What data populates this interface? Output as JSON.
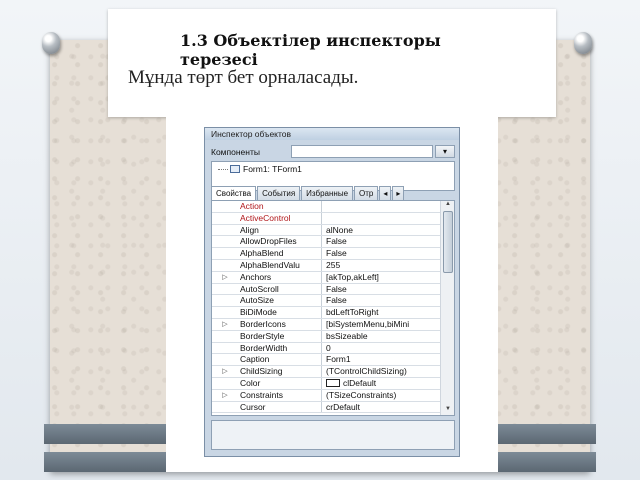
{
  "slide": {
    "title": "1.3 Объектілер инспекторы терезесі",
    "subtitle": "Мұнда төрт бет орналасады."
  },
  "inspector": {
    "window_title": "Инспектор объектов",
    "components_label": "Компоненты",
    "combo_button_icon": "dropdown-icon",
    "tree_item": "Form1: TForm1",
    "tabs": [
      {
        "label": "Свойства",
        "active": true
      },
      {
        "label": "События",
        "active": false
      },
      {
        "label": "Избранные",
        "active": false
      },
      {
        "label": "Отр",
        "active": false
      }
    ],
    "tab_nav": [
      "◂",
      "▸"
    ],
    "properties": [
      {
        "name": "Action",
        "value": "",
        "expandable": false,
        "event": true
      },
      {
        "name": "ActiveControl",
        "value": "",
        "expandable": false,
        "event": true
      },
      {
        "name": "Align",
        "value": "alNone",
        "expandable": false,
        "event": false
      },
      {
        "name": "AllowDropFiles",
        "value": "False",
        "expandable": false,
        "event": false
      },
      {
        "name": "AlphaBlend",
        "value": "False",
        "expandable": false,
        "event": false
      },
      {
        "name": "AlphaBlendValu",
        "value": "255",
        "expandable": false,
        "event": false
      },
      {
        "name": "Anchors",
        "value": "[akTop,akLeft]",
        "expandable": true,
        "event": false
      },
      {
        "name": "AutoScroll",
        "value": "False",
        "expandable": false,
        "event": false
      },
      {
        "name": "AutoSize",
        "value": "False",
        "expandable": false,
        "event": false
      },
      {
        "name": "BiDiMode",
        "value": "bdLeftToRight",
        "expandable": false,
        "event": false
      },
      {
        "name": "BorderIcons",
        "value": "[biSystemMenu,biMini",
        "expandable": true,
        "event": false
      },
      {
        "name": "BorderStyle",
        "value": "bsSizeable",
        "expandable": false,
        "event": false
      },
      {
        "name": "BorderWidth",
        "value": "0",
        "expandable": false,
        "event": false
      },
      {
        "name": "Caption",
        "value": "Form1",
        "expandable": false,
        "event": false
      },
      {
        "name": "ChildSizing",
        "value": "(TControlChildSizing)",
        "expandable": true,
        "event": false
      },
      {
        "name": "Color",
        "value": "clDefault",
        "expandable": false,
        "event": false,
        "swatch": "#ffffff"
      },
      {
        "name": "Constraints",
        "value": "(TSizeConstraints)",
        "expandable": true,
        "event": false
      },
      {
        "name": "Cursor",
        "value": "crDefault",
        "expandable": false,
        "event": false
      }
    ],
    "colors": {
      "event_text": "#b0161a",
      "window_bg": "#c9d6e4"
    }
  }
}
